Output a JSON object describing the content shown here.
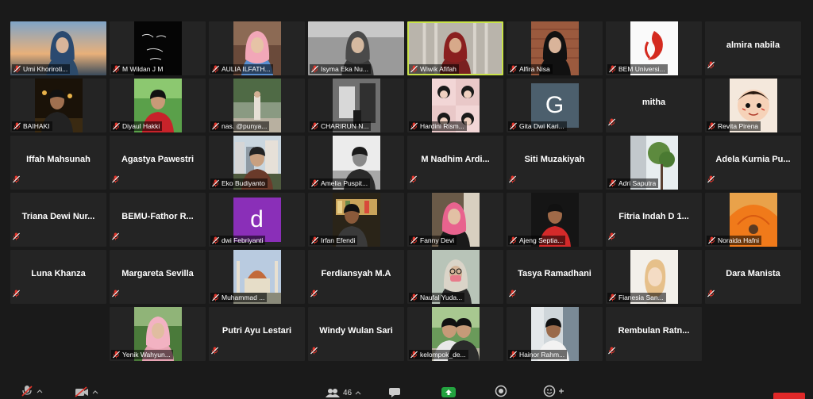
{
  "participant_count": "46",
  "colors": {
    "active_border": "#c9e34a",
    "mic_muted": "#e0352b",
    "share_green": "#23a33f",
    "leave_red": "#e02828"
  },
  "tiles": [
    {
      "name": "Umi Khoriroti...",
      "mode": "video",
      "scene": "sunset"
    },
    {
      "name": "M Wildan J M",
      "mode": "video",
      "scene": "dark-text"
    },
    {
      "name": "AULIA ILFATH...",
      "mode": "video",
      "scene": "hijab-pink"
    },
    {
      "name": "Isyma Eka Nu...",
      "mode": "video",
      "scene": "grey-wide"
    },
    {
      "name": "Wiwik Afifah",
      "mode": "video",
      "scene": "hijab-dark",
      "active": true
    },
    {
      "name": "Alfira Nisa",
      "mode": "video",
      "scene": "brick"
    },
    {
      "name": "BEM Universi...",
      "mode": "video",
      "scene": "logo"
    },
    {
      "name": "almira nabila",
      "mode": "name"
    },
    {
      "name": "BAIHAKI",
      "mode": "video",
      "scene": "night"
    },
    {
      "name": "Diyaul Hakki",
      "mode": "video",
      "scene": "green"
    },
    {
      "name": "nas. @punya...",
      "mode": "video",
      "scene": "street"
    },
    {
      "name": "CHARIRUN N...",
      "mode": "video",
      "scene": "bw"
    },
    {
      "name": "Hardini Rism...",
      "mode": "video",
      "scene": "collage"
    },
    {
      "name": "Gita Dwi Kari...",
      "mode": "initial",
      "initial": "G",
      "bg": "#4c5f6d"
    },
    {
      "name": "mitha",
      "mode": "name"
    },
    {
      "name": "Revita Pirena",
      "mode": "video",
      "scene": "cartoon"
    },
    {
      "name": "Iffah Mahsunah",
      "mode": "name"
    },
    {
      "name": "Agastya Pawestri",
      "mode": "name"
    },
    {
      "name": "Eko Budiyanto",
      "mode": "video",
      "scene": "city"
    },
    {
      "name": "Amelia Puspit...",
      "mode": "video",
      "scene": "bw2"
    },
    {
      "name": "M Nadhim Ardi...",
      "mode": "name"
    },
    {
      "name": "Siti Muzakiyah",
      "mode": "name"
    },
    {
      "name": "Adri Saputra",
      "mode": "video",
      "scene": "tree"
    },
    {
      "name": "Adela Kurnia Pu...",
      "mode": "name"
    },
    {
      "name": "Triana Dewi Nur...",
      "mode": "name"
    },
    {
      "name": "BEMU-Fathor R...",
      "mode": "name"
    },
    {
      "name": "dwi Febriyanti",
      "mode": "initial",
      "initial": "d",
      "bg": "#8a2fb8"
    },
    {
      "name": "Irfan Efendi",
      "mode": "video",
      "scene": "shop"
    },
    {
      "name": "Fanny Devi",
      "mode": "video",
      "scene": "hijab-pink2"
    },
    {
      "name": "Ajeng Septia...",
      "mode": "video",
      "scene": "portrait-red"
    },
    {
      "name": "Fitria Indah D 1...",
      "mode": "name"
    },
    {
      "name": "Noraida Hafni",
      "mode": "video",
      "scene": "orange"
    },
    {
      "name": "Luna Khanza",
      "mode": "name"
    },
    {
      "name": "Margareta Sevilla",
      "mode": "name"
    },
    {
      "name": "Muhammad ...",
      "mode": "video",
      "scene": "mosque"
    },
    {
      "name": "Ferdiansyah M.A",
      "mode": "name"
    },
    {
      "name": "Naufal Yuda...",
      "mode": "video",
      "scene": "mask"
    },
    {
      "name": "Tasya Ramadhani",
      "mode": "name"
    },
    {
      "name": "Fianesia San...",
      "mode": "video",
      "scene": "sketch"
    },
    {
      "name": "Dara Manista",
      "mode": "name"
    },
    {
      "name": "",
      "mode": "empty"
    },
    {
      "name": "Yenik Wahyun...",
      "mode": "video",
      "scene": "hijab-outdoor"
    },
    {
      "name": "Putri Ayu Lestari",
      "mode": "name"
    },
    {
      "name": "Windy Wulan Sari",
      "mode": "name"
    },
    {
      "name": "kelompok_de...",
      "mode": "video",
      "scene": "park"
    },
    {
      "name": "Hainor Rahm...",
      "mode": "video",
      "scene": "boy"
    },
    {
      "name": "Rembulan Ratn...",
      "mode": "name"
    }
  ]
}
